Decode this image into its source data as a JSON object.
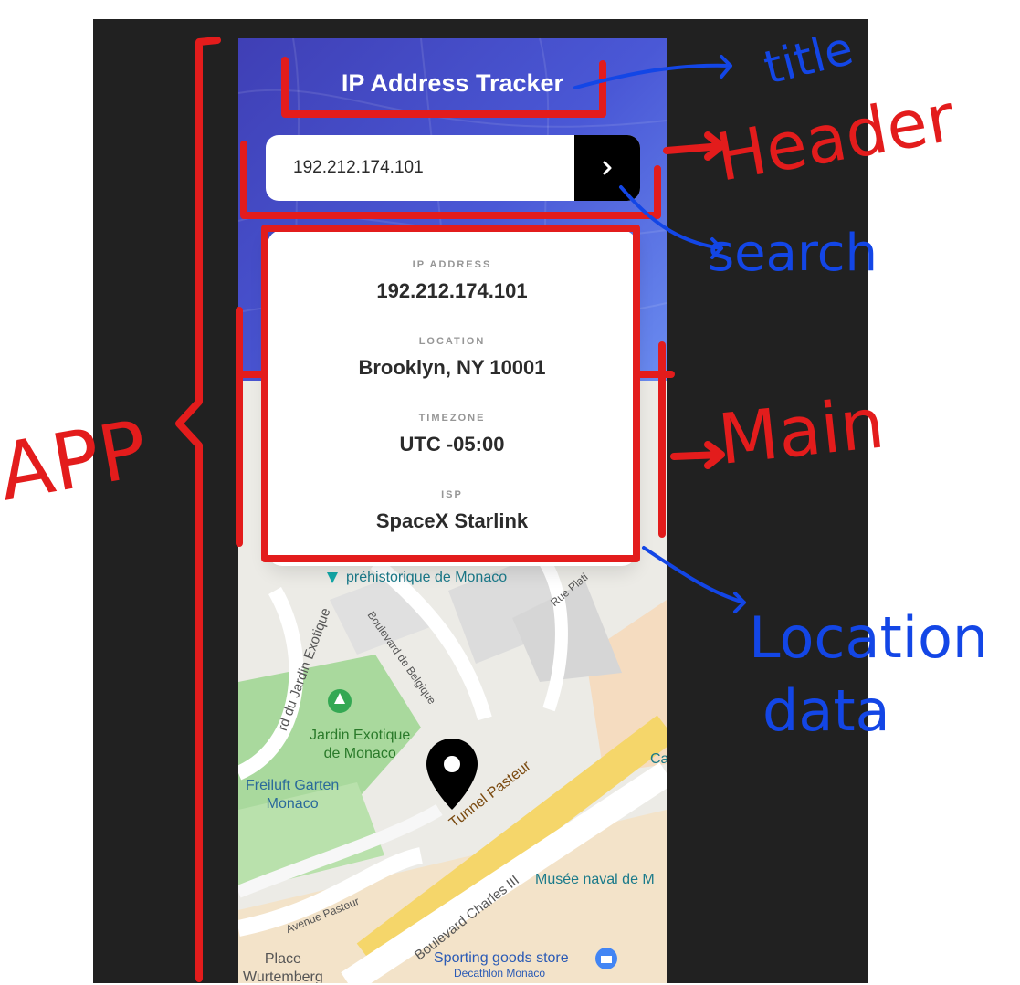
{
  "app": {
    "title": "IP Address Tracker"
  },
  "search": {
    "value": "192.212.174.101",
    "button_icon": "chevron-right-icon"
  },
  "info": [
    {
      "label": "IP ADDRESS",
      "value": "192.212.174.101"
    },
    {
      "label": "LOCATION",
      "value": "Brooklyn, NY 10001"
    },
    {
      "label": "TIMEZONE",
      "value": "UTC -05:00"
    },
    {
      "label": "ISP",
      "value": "SpaceX Starlink"
    }
  ],
  "map": {
    "labels": {
      "museum_partial": "préhistorique de Monaco",
      "rue_plati": "Rue Plati",
      "blvd_belgique": "Boulevard de Belgique",
      "blvd_jardin": "rd du Jardin Exotique",
      "jardin": "Jardin Exotique\nde Monaco",
      "freiluft": "Freiluft Garten\nMonaco",
      "tunnel": "Tunnel Pasteur",
      "avenue_pasteur": "Avenue Pasteur",
      "blvd_charles": "Boulevard Charles III",
      "musee_naval": "Musée naval de M",
      "ca": "Ca",
      "place": "Place\nWurtemberg",
      "sporting": "Sporting goods store",
      "decathlon": "Decathlon Monaco"
    },
    "marker_icon": "map-pin-icon"
  },
  "annotations": {
    "title": "title",
    "header": "Header",
    "search": "search",
    "main": "Main",
    "app": "APP",
    "location": "Location",
    "location2": "data"
  },
  "colors": {
    "header_start": "#3f3fb5",
    "header_end": "#6a8cf0",
    "annotation_red": "#e31c1c",
    "annotation_blue": "#1346e6"
  }
}
